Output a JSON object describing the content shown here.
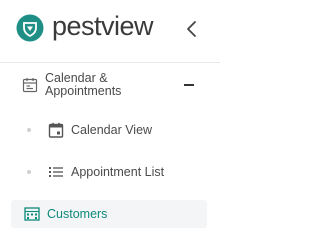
{
  "brand": {
    "name": "pestview",
    "accent": "#1f8f86"
  },
  "header": {
    "collapse_icon": "chevron-left-icon"
  },
  "nav": {
    "group": {
      "label": "Calendar & Appointments",
      "icon": "calendar-icon",
      "expanded": true,
      "toggle_icon": "minus-icon"
    },
    "sub_items": [
      {
        "label": "Calendar View",
        "icon": "calendar-event-icon"
      },
      {
        "label": "Appointment List",
        "icon": "list-icon"
      }
    ],
    "active_item": {
      "label": "Customers",
      "icon": "building-icon",
      "color": "#0e8a7a"
    }
  }
}
